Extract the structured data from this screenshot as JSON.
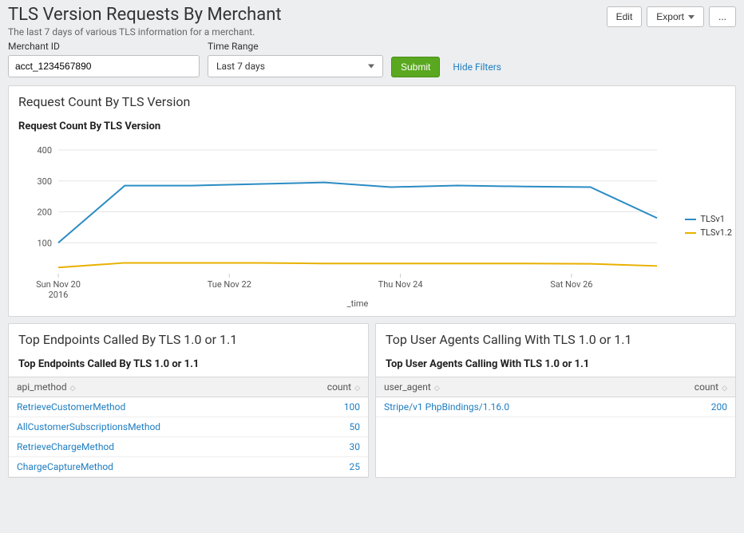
{
  "header": {
    "title": "TLS Version Requests By Merchant",
    "subtitle": "The last 7 days of various TLS information for a merchant.",
    "edit": "Edit",
    "export": "Export",
    "more": "..."
  },
  "filters": {
    "merchant_id_label": "Merchant ID",
    "merchant_id_value": "acct_1234567890",
    "time_range_label": "Time Range",
    "time_range_value": "Last 7 days",
    "submit": "Submit",
    "hide_filters": "Hide Filters"
  },
  "chart_panel": {
    "title": "Request Count By TLS Version",
    "subtitle": "Request Count By TLS Version",
    "xaxis_title": "_time"
  },
  "chart_data": {
    "type": "line",
    "x": [
      "Sun Nov 20\n2016",
      "",
      "Tue Nov 22",
      "",
      "Thu Nov 24",
      "",
      "Sat Nov 26",
      ""
    ],
    "categories_idx": [
      0,
      1,
      2,
      3,
      4,
      5,
      6,
      7
    ],
    "series": [
      {
        "name": "TLSv1",
        "color": "#2b8cc4",
        "values": [
          100,
          285,
          285,
          290,
          295,
          280,
          285,
          282,
          280,
          180
        ]
      },
      {
        "name": "TLSv1.2",
        "color": "#e8b000",
        "values": [
          20,
          35,
          35,
          35,
          33,
          33,
          33,
          33,
          32,
          25
        ]
      }
    ],
    "ylim": [
      0,
      400
    ],
    "yticks": [
      100,
      200,
      300,
      400
    ],
    "xtick_labels": [
      "Sun Nov 20",
      "Tue Nov 22",
      "Thu Nov 24",
      "Sat Nov 26"
    ],
    "xtick_sub": "2016",
    "xlabel": "_time"
  },
  "endpoints_panel": {
    "title": "Top Endpoints Called By TLS 1.0 or 1.1",
    "subtitle": "Top Endpoints Called By TLS 1.0 or 1.1",
    "col_method": "api_method",
    "col_count": "count",
    "rows": [
      {
        "method": "RetrieveCustomerMethod",
        "count": "100"
      },
      {
        "method": "AllCustomerSubscriptionsMethod",
        "count": "50"
      },
      {
        "method": "RetrieveChargeMethod",
        "count": "30"
      },
      {
        "method": "ChargeCaptureMethod",
        "count": "25"
      }
    ]
  },
  "useragents_panel": {
    "title": "Top User Agents Calling With TLS 1.0 or 1.1",
    "subtitle": "Top User Agents Calling With TLS 1.0 or 1.1",
    "col_ua": "user_agent",
    "col_count": "count",
    "rows": [
      {
        "ua": "Stripe/v1 PhpBindings/1.16.0",
        "count": "200"
      }
    ]
  }
}
